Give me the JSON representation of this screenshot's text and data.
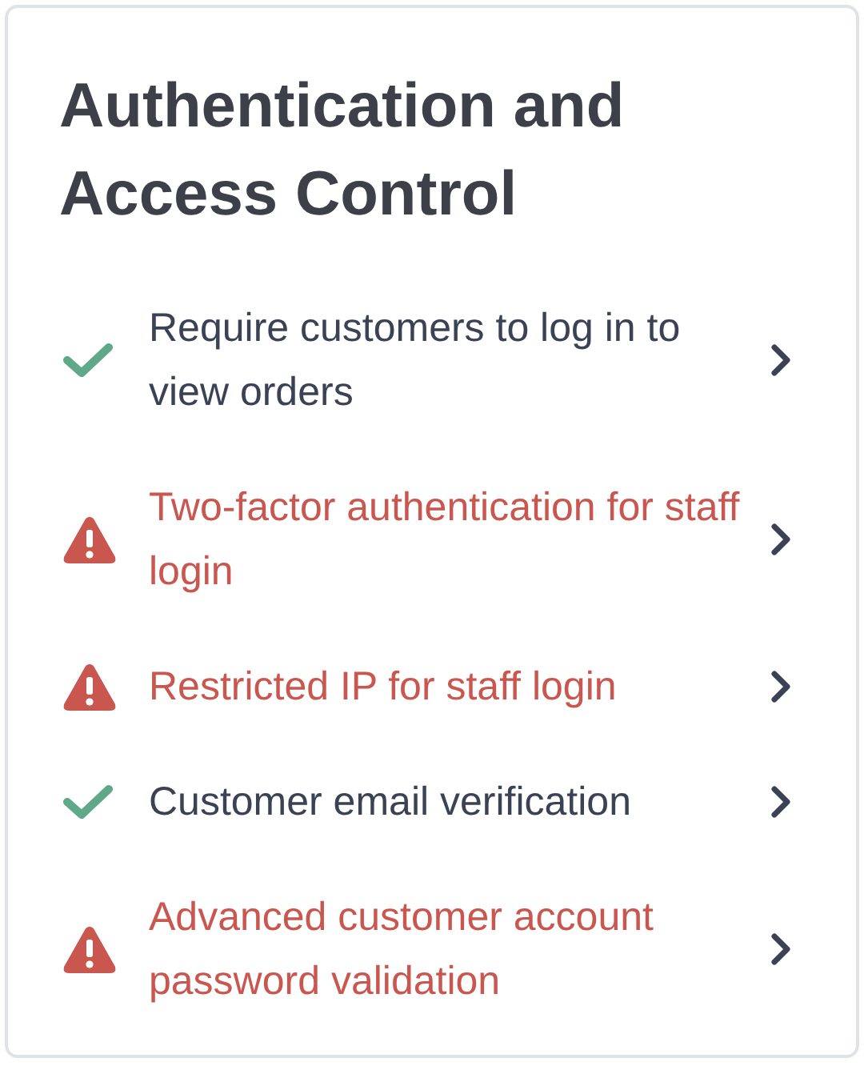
{
  "card": {
    "title": "Authentication and Access Control",
    "items": [
      {
        "label": "Require customers to log in to view orders",
        "kind": "ok"
      },
      {
        "label": "Two-factor authentication for staff login",
        "kind": "warning"
      },
      {
        "label": "Restricted IP for staff login",
        "kind": "warning"
      },
      {
        "label": "Customer email verification",
        "kind": "ok"
      },
      {
        "label": "Advanced customer account password validation",
        "kind": "warning"
      }
    ]
  }
}
